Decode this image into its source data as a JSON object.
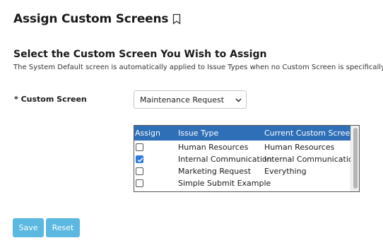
{
  "page": {
    "title": "Assign Custom Screens",
    "section_title": "Select the Custom Screen You Wish to Assign",
    "section_description": "The System Default screen is automatically applied to Issue Types when no Custom Screen is specifically as"
  },
  "form": {
    "custom_screen_label": "* Custom Screen",
    "custom_screen_value": "Maintenance Request"
  },
  "issue_list": {
    "headers": {
      "assign": "Assign",
      "issue_type": "Issue Type",
      "current_custom_screen": "Current Custom Screen"
    },
    "rows": [
      {
        "checked": false,
        "issue_type": "Human Resources",
        "current_screen": "Human Resources"
      },
      {
        "checked": true,
        "issue_type": "Internal Communication",
        "current_screen": "Internal Communication"
      },
      {
        "checked": false,
        "issue_type": "Marketing Request",
        "current_screen": "Everything"
      },
      {
        "checked": false,
        "issue_type": "Simple Submit Example",
        "current_screen": ""
      }
    ]
  },
  "actions": {
    "save_label": "Save",
    "reset_label": "Reset"
  },
  "colors": {
    "header_bg": "#2f6fb7",
    "button_bg": "#5bb8e0",
    "checkbox_checked": "#2f7be0"
  },
  "icons": {
    "title_icon": "bookmark-icon",
    "select_icon": "chevron-down-icon",
    "checkbox_check": "check-icon"
  }
}
